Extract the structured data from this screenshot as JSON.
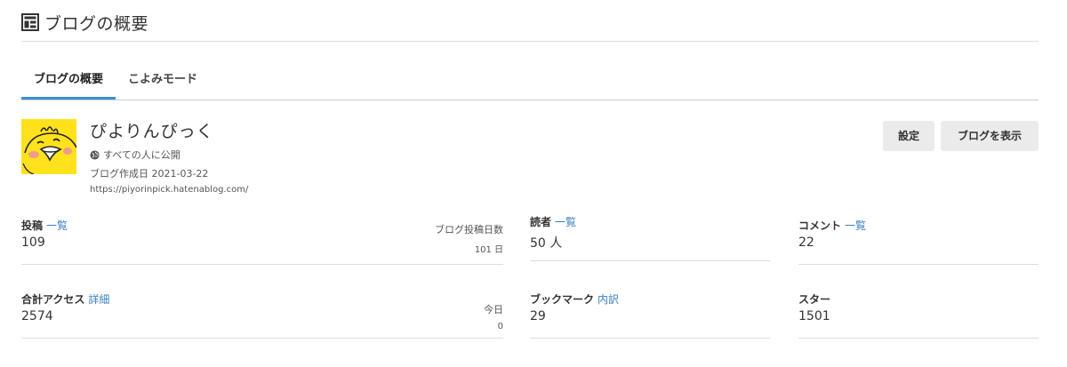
{
  "header": {
    "title": "ブログの概要",
    "icon": "dashboard-icon"
  },
  "tabs": [
    {
      "label": "ブログの概要",
      "active": true
    },
    {
      "label": "こよみモード",
      "active": false
    }
  ],
  "blog": {
    "name": "ぴよりんぴっく",
    "visibility": "すべての人に公開",
    "created": "ブログ作成日 2021-03-22",
    "url": "https://piyorinpick.hatenablog.com/"
  },
  "buttons": {
    "settings": "設定",
    "view_blog": "ブログを表示"
  },
  "stats": {
    "posts": {
      "label": "投稿",
      "link": "一覧",
      "value": "109",
      "side_label": "ブログ投稿日数",
      "side_value": "101 日"
    },
    "readers": {
      "label": "読者",
      "link": "一覧",
      "value": "50 人"
    },
    "comments": {
      "label": "コメント",
      "link": "一覧",
      "value": "22"
    },
    "access": {
      "label": "合計アクセス",
      "link": "詳細",
      "value": "2574",
      "side_label": "今日",
      "side_value": "0"
    },
    "bookmarks": {
      "label": "ブックマーク",
      "link": "内訳",
      "value": "29"
    },
    "stars": {
      "label": "スター",
      "value": "1501"
    }
  },
  "colors": {
    "accent": "#3b8fd8",
    "link": "#3b7fc4",
    "avatar_bg": "#ffe21c"
  }
}
